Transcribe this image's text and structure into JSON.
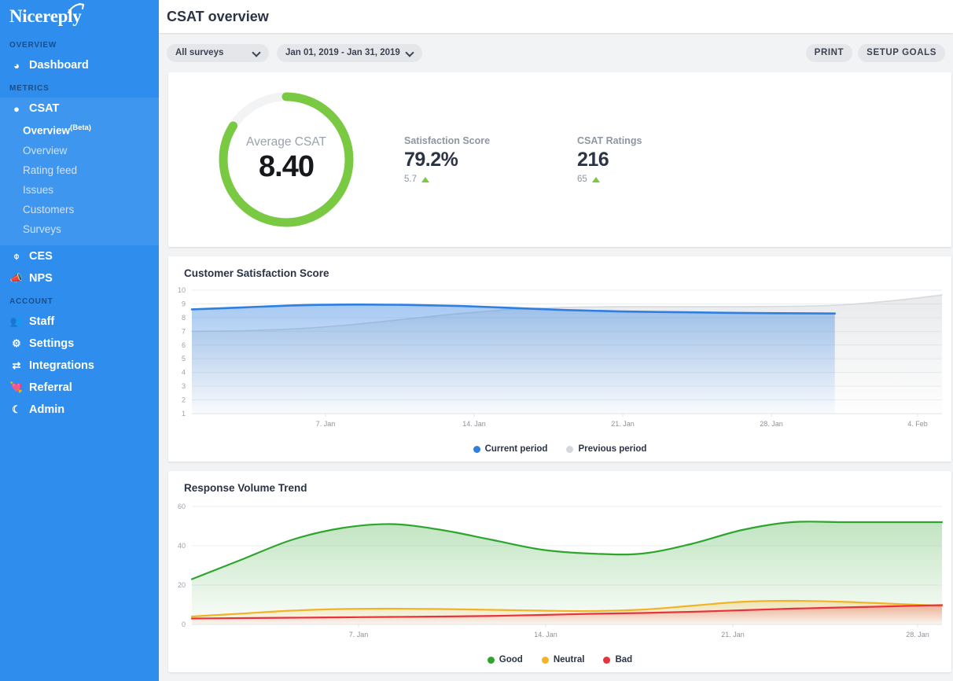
{
  "brand": {
    "name": "Nicereply"
  },
  "sidebar": {
    "groups": [
      {
        "label": "OVERVIEW",
        "items": [
          {
            "label": "Dashboard",
            "icon": "dashboard-icon"
          }
        ]
      },
      {
        "label": "METRICS",
        "items": [
          {
            "label": "CSAT",
            "icon": "speech-bubble-icon"
          },
          {
            "label": "CES",
            "icon": "gauge-icon"
          },
          {
            "label": "NPS",
            "icon": "megaphone-icon"
          }
        ]
      },
      {
        "label": "ACCOUNT",
        "items": [
          {
            "label": "Staff",
            "icon": "people-icon"
          },
          {
            "label": "Settings",
            "icon": "gear-icon"
          },
          {
            "label": "Integrations",
            "icon": "arrows-icon"
          },
          {
            "label": "Referral",
            "icon": "heart-hand-icon"
          },
          {
            "label": "Admin",
            "icon": "shield-icon"
          }
        ]
      }
    ],
    "csat_sub": [
      {
        "label": "Overview",
        "badge": "(Beta)",
        "active": true
      },
      {
        "label": "Overview",
        "active": false
      },
      {
        "label": "Rating feed",
        "active": false
      },
      {
        "label": "Issues",
        "active": false
      },
      {
        "label": "Customers",
        "active": false
      },
      {
        "label": "Surveys",
        "active": false
      }
    ]
  },
  "header": {
    "title": "CSAT overview"
  },
  "toolbar": {
    "survey_select": "All surveys",
    "date_range": "Jan 01, 2019 - Jan 31, 2019",
    "print_label": "PRINT",
    "setup_goals_label": "SETUP GOALS"
  },
  "kpi": {
    "donut": {
      "label": "Average CSAT",
      "value": "8.40",
      "percent": 84,
      "color": "#7ac943",
      "track": "#f2f3f5"
    },
    "metrics": [
      {
        "label": "Satisfaction Score",
        "value": "79.2%",
        "delta": "5.7",
        "direction": "up"
      },
      {
        "label": "CSAT Ratings",
        "value": "216",
        "delta": "65",
        "direction": "up"
      }
    ]
  },
  "chart_data": [
    {
      "type": "area",
      "title": "Customer Satisfaction Score",
      "xlabel": "",
      "ylabel": "",
      "ylim": [
        1,
        10
      ],
      "yticks": [
        10,
        9,
        8,
        7,
        6,
        5,
        4,
        3,
        2,
        1
      ],
      "xticks": [
        "7. Jan",
        "14. Jan",
        "21. Jan",
        "28. Jan",
        "4. Feb"
      ],
      "grid": true,
      "legend_position": "bottom",
      "series": [
        {
          "name": "Current period",
          "color": "#2f7fe0",
          "values": [
            8.6,
            8.75,
            8.9,
            8.95,
            8.93,
            8.85,
            8.7,
            8.55,
            8.45,
            8.4,
            8.35,
            8.32,
            8.3,
            null,
            null
          ]
        },
        {
          "name": "Previous period",
          "color": "#c9cdd2",
          "values": [
            7.0,
            7.05,
            7.2,
            7.5,
            7.9,
            8.3,
            8.6,
            8.75,
            8.8,
            8.8,
            8.8,
            8.82,
            8.9,
            9.2,
            9.65
          ]
        }
      ]
    },
    {
      "type": "area",
      "title": "Response Volume Trend",
      "xlabel": "",
      "ylabel": "",
      "ylim": [
        0,
        60
      ],
      "yticks": [
        60,
        40,
        20,
        0
      ],
      "xticks": [
        "7. Jan",
        "14. Jan",
        "21. Jan",
        "28. Jan"
      ],
      "grid": true,
      "legend_position": "bottom",
      "series": [
        {
          "name": "Good",
          "color": "#2fa52f",
          "values": [
            23,
            33,
            43,
            49,
            51,
            48,
            43,
            38,
            36,
            36,
            41,
            48,
            52,
            52,
            52,
            52
          ]
        },
        {
          "name": "Neutral",
          "color": "#f0b429",
          "values": [
            4,
            5.5,
            7,
            7.8,
            8,
            7.8,
            7.4,
            7,
            6.8,
            7.5,
            9.5,
            11.5,
            12,
            11.5,
            10.5,
            9.5
          ]
        },
        {
          "name": "Bad",
          "color": "#e8323c",
          "values": [
            3,
            3.2,
            3.4,
            3.6,
            3.8,
            4,
            4.3,
            4.8,
            5.4,
            5.8,
            6.4,
            7.2,
            8,
            8.6,
            9.2,
            9.8
          ]
        }
      ]
    }
  ]
}
